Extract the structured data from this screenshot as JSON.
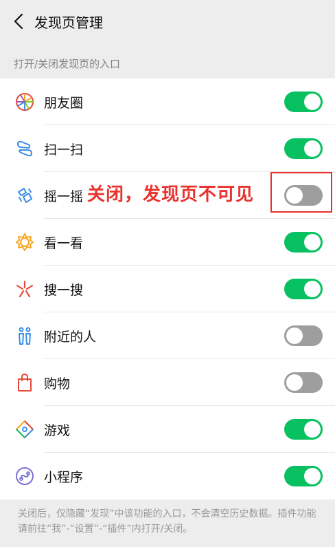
{
  "header": {
    "title": "发现页管理"
  },
  "section_label": "打开/关闭发现页的入口",
  "items": [
    {
      "label": "朋友圈",
      "on": true,
      "icon": "moments-icon"
    },
    {
      "label": "扫一扫",
      "on": true,
      "icon": "scan-icon"
    },
    {
      "label": "摇一摇",
      "on": false,
      "icon": "shake-icon"
    },
    {
      "label": "看一看",
      "on": true,
      "icon": "top-stories-icon"
    },
    {
      "label": "搜一搜",
      "on": true,
      "icon": "search-icon"
    },
    {
      "label": "附近的人",
      "on": false,
      "icon": "people-nearby-icon"
    },
    {
      "label": "购物",
      "on": false,
      "icon": "shopping-bag-icon"
    },
    {
      "label": "游戏",
      "on": true,
      "icon": "games-icon"
    },
    {
      "label": "小程序",
      "on": true,
      "icon": "mini-programs-icon"
    }
  ],
  "footer_note": "关闭后，仅隐藏“发现”中该功能的入口，不会清空历史数据。插件功能请前往“我”-“设置”-“插件”内打开/关闭。",
  "annotation": {
    "text": "关闭，发现页不可见"
  },
  "colors": {
    "toggle_on": "#07c160",
    "toggle_off": "#9e9e9e",
    "annotation": "#e8322d"
  }
}
